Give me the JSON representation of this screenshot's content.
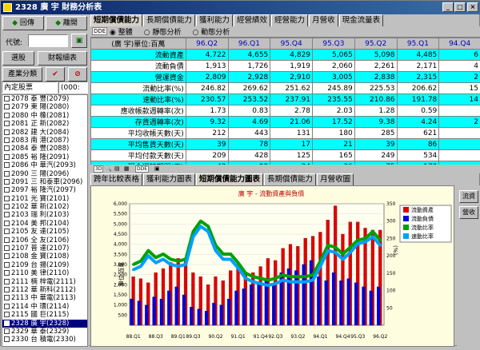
{
  "window": {
    "title": "2328  廣    宇 財務分析表",
    "controls": [
      "_",
      "□",
      "×"
    ]
  },
  "left": {
    "back_btn": "回傳",
    "exit_btn": "離開",
    "code_label": "代號:",
    "code_value": "",
    "pick_btn": "選股",
    "finance_btn": "財報細表",
    "industry_btn": "產業分類",
    "filter_value": "內定股票",
    "filter_option": "(000:",
    "stocks": [
      "2078 泰    豐(2079)",
      "2079 東    陽(2080)",
      "2080 中    橡(2081)",
      "2081 正    新(2082)",
      "2082 建    大(2084)",
      "2083 南    港(2087)",
      "2084 泰    豐(2088)",
      "2085 裕    隆(2091)",
      "2086 中    華汽(2093)",
      "2090 三    陽(2096)",
      "2091 三    和泰車(2096)",
      "2097 裕    隆汽(2097)",
      "2101 光    寶(2101)",
      "2102 華    新(2102)",
      "2103 瑞    利(2103)",
      "2104 美    邦(2104)",
      "2105 友    達(2105)",
      "2106 全    友(2106)",
      "2107 普    達(2107)",
      "2108 金    寶(2108)",
      "2109 台    揚(2109)",
      "2110 美    律(2110)",
      "2111 楠    梓電(2111)",
      "2112 華    新科(2112)",
      "2113 中    華電(2113)",
      "2114 中    環(2114)",
      "2115 國    巨(2115)",
      "2328 廣    宇(2328)",
      "2329 華    泰(2329)",
      "2330 台    積電(2330)"
    ],
    "selected_index": 27
  },
  "tabs_top": [
    "短期償債能力",
    "長期償債能力",
    "獲利能力",
    "經營績效",
    "經營能力",
    "月營收",
    "現金流量表"
  ],
  "tabs_top_active": 0,
  "toolbar": {
    "tool_label": "DDE",
    "radio": [
      "整體",
      "靜態分析",
      "動態分析"
    ],
    "radio_selected": 0
  },
  "table": {
    "header_label": "(廣    宇)單位:百萬",
    "periods": [
      "96.Q2",
      "96.Q1",
      "95.Q4",
      "95.Q3",
      "95.Q2",
      "95.Q1",
      "94.Q4"
    ],
    "rows": [
      {
        "label": "流動資產",
        "cyan": true,
        "values": [
          "4,722",
          "4,655",
          "4,829",
          "5,065",
          "5,098",
          "4,485",
          "6"
        ]
      },
      {
        "label": "流動負債",
        "cyan": false,
        "values": [
          "1,913",
          "1,726",
          "1,919",
          "2,060",
          "2,261",
          "2,171",
          "4"
        ]
      },
      {
        "label": "營運資金",
        "cyan": true,
        "values": [
          "2,809",
          "2,928",
          "2,910",
          "3,005",
          "2,838",
          "2,315",
          "2"
        ]
      },
      {
        "label": "流動比率(%)",
        "cyan": false,
        "values": [
          "246.82",
          "269.62",
          "251.62",
          "245.89",
          "225.53",
          "206.62",
          "15"
        ]
      },
      {
        "label": "速動比率(%)",
        "cyan": true,
        "values": [
          "230.57",
          "253.52",
          "237.91",
          "235.55",
          "210.86",
          "191.78",
          "14"
        ]
      },
      {
        "label": "應收帳款週轉率(次)",
        "cyan": false,
        "values": [
          "1.73",
          "0.83",
          "2.78",
          "2.03",
          "1.28",
          "0.59",
          ""
        ]
      },
      {
        "label": "存貨週轉率(次)",
        "cyan": true,
        "values": [
          "9.32",
          "4.69",
          "21.06",
          "17.52",
          "9.38",
          "4.24",
          "2"
        ]
      },
      {
        "label": "平均收帳天數(天)",
        "cyan": false,
        "values": [
          "212",
          "443",
          "131",
          "180",
          "285",
          "621",
          ""
        ]
      },
      {
        "label": "平均售貨天數(天)",
        "cyan": true,
        "values": [
          "39",
          "78",
          "17",
          "21",
          "39",
          "86",
          ""
        ]
      },
      {
        "label": "平均付款天數(天)",
        "cyan": false,
        "values": [
          "209",
          "428",
          "125",
          "165",
          "249",
          "534",
          ""
        ]
      },
      {
        "label": "現金週轉期間(天)",
        "cyan": true,
        "values": [
          "42",
          "92",
          "24",
          "36",
          "75",
          "173",
          ""
        ]
      }
    ]
  },
  "chart_toolbar_label": "DDE",
  "tabs_chart": [
    "跨年比較表格",
    "獲利能力圖表",
    "短期償債能力圖表",
    "長期償債能力",
    "月營收圖"
  ],
  "tabs_chart_active": 2,
  "right_buttons": [
    "流資",
    "營收"
  ],
  "chart_data": {
    "type": "bar",
    "title": "廣    宇 - 流動資產與負債",
    "ylabel_left": "單位:百萬",
    "ylabel_right": "(%)",
    "ylim_left": [
      0,
      6000
    ],
    "ylim_right": [
      0,
      350
    ],
    "yticks_left": [
      "500",
      "1,000",
      "1,500",
      "2,000",
      "2,500",
      "3,000",
      "3,500",
      "4,000",
      "4,500",
      "5,000",
      "5,500",
      "6,000"
    ],
    "yticks_right": [
      "50",
      "100",
      "150",
      "200",
      "250",
      "300",
      "350"
    ],
    "x_tick_labels": [
      "88.Q1",
      "88.Q3",
      "89.Q1",
      "89.Q3",
      "90.Q2",
      "91.Q1",
      "91.Q4",
      "92.Q3",
      "93.Q2",
      "94.Q1",
      "94.Q4",
      "95.Q3",
      "96.Q2"
    ],
    "legend": [
      "流動資產",
      "流動負債",
      "流動比率",
      "速動比率"
    ],
    "legend_position": "right",
    "colors": {
      "assets": "#e00000",
      "liabilities": "#0000e0",
      "current_ratio": "#00a000",
      "quick_ratio": "#00a0ff"
    },
    "x": [
      "88.Q1",
      "88.Q2",
      "88.Q3",
      "88.Q4",
      "89.Q1",
      "89.Q2",
      "89.Q3",
      "89.Q4",
      "90.Q1",
      "90.Q2",
      "90.Q3",
      "90.Q4",
      "91.Q1",
      "91.Q2",
      "91.Q3",
      "91.Q4",
      "92.Q1",
      "92.Q2",
      "92.Q3",
      "92.Q4",
      "93.Q1",
      "93.Q2",
      "93.Q3",
      "93.Q4",
      "94.Q1",
      "94.Q2",
      "94.Q3",
      "94.Q4",
      "95.Q1",
      "95.Q2",
      "95.Q3",
      "95.Q4",
      "96.Q1",
      "96.Q2"
    ],
    "series": [
      {
        "name": "流動資產",
        "values": [
          2400,
          2300,
          2100,
          2600,
          2800,
          3100,
          3300,
          3200,
          2600,
          2400,
          2000,
          2400,
          2200,
          2700,
          3000,
          2600,
          2600,
          2900,
          3300,
          3200,
          3800,
          4000,
          3900,
          4300,
          4400,
          4600,
          5200,
          5900,
          4500,
          5100,
          5100,
          4800,
          4700,
          4700
        ]
      },
      {
        "name": "流動負債",
        "values": [
          1300,
          1200,
          1000,
          1400,
          1300,
          1700,
          1900,
          1500,
          900,
          800,
          700,
          1100,
          1000,
          1300,
          1700,
          1800,
          2000,
          2100,
          2300,
          2000,
          2600,
          2800,
          2700,
          3000,
          3200,
          2400,
          2200,
          2600,
          2200,
          2300,
          2100,
          1900,
          1700,
          1900
        ]
      },
      {
        "name": "流動比率",
        "values": [
          175,
          185,
          215,
          195,
          205,
          190,
          185,
          190,
          270,
          300,
          285,
          230,
          205,
          205,
          180,
          150,
          140,
          135,
          130,
          135,
          145,
          140,
          140,
          140,
          145,
          185,
          230,
          225,
          205,
          225,
          245,
          250,
          270,
          245
        ]
      },
      {
        "name": "速動比率",
        "values": [
          160,
          170,
          200,
          180,
          190,
          175,
          170,
          175,
          255,
          285,
          270,
          215,
          190,
          190,
          165,
          135,
          125,
          120,
          115,
          120,
          130,
          125,
          125,
          125,
          130,
          170,
          215,
          210,
          190,
          210,
          235,
          240,
          255,
          230
        ]
      }
    ]
  }
}
